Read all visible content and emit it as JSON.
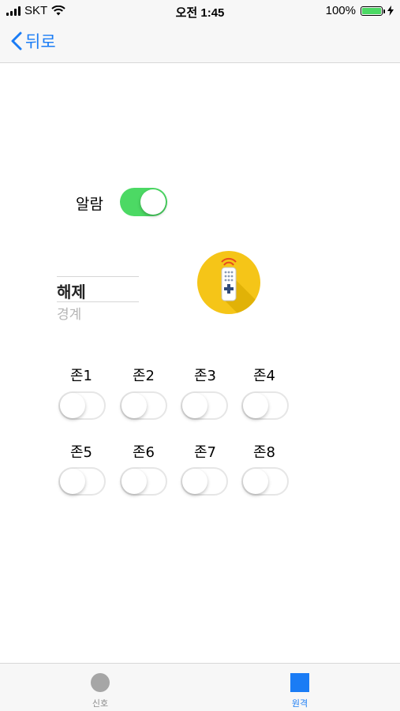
{
  "status_bar": {
    "carrier": "SKT",
    "time": "오전 1:45",
    "battery": "100%",
    "battery_level": 1.0
  },
  "nav": {
    "back_label": "뒤로"
  },
  "alarm": {
    "label": "알람",
    "on": true
  },
  "picker": {
    "selected": "해제",
    "next": "경계"
  },
  "remote_icon": "remote-control-icon",
  "zones": [
    {
      "label": "존1",
      "on": false
    },
    {
      "label": "존2",
      "on": false
    },
    {
      "label": "존3",
      "on": false
    },
    {
      "label": "존4",
      "on": false
    },
    {
      "label": "존5",
      "on": false
    },
    {
      "label": "존6",
      "on": false
    },
    {
      "label": "존7",
      "on": false
    },
    {
      "label": "존8",
      "on": false
    }
  ],
  "tabs": [
    {
      "label": "신호",
      "icon": "circle-icon",
      "selected": false
    },
    {
      "label": "원격",
      "icon": "square-icon",
      "selected": true
    }
  ],
  "colors": {
    "accent": "#1a7cf5",
    "toggle_on": "#4cd964",
    "remote_bg": "#f5c518",
    "tab_inactive": "#a6a6a6"
  }
}
